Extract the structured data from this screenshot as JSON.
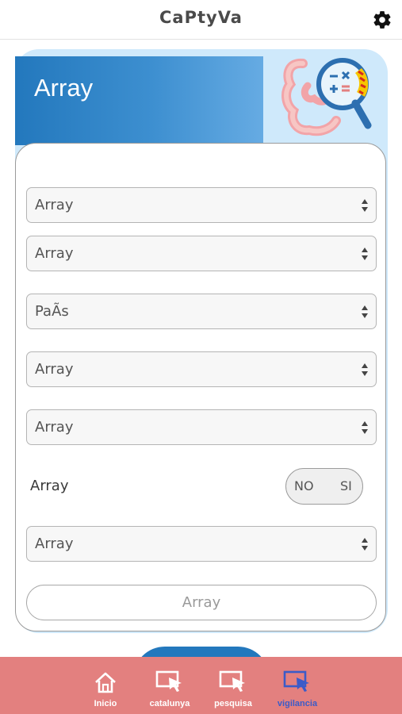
{
  "app": {
    "title": "CaPtyVa"
  },
  "header": {
    "title": "Array"
  },
  "form": {
    "selects": [
      "Array",
      "Array",
      "PaÃs",
      "Array",
      "Array",
      "Array"
    ],
    "toggle": {
      "label": "Array",
      "no": "NO",
      "si": "SI"
    },
    "submit_label": "Array"
  },
  "nav": [
    {
      "label": "Inicio",
      "icon": "home-icon",
      "active": false
    },
    {
      "label": "catalunya",
      "icon": "cursor-screen-icon",
      "active": false
    },
    {
      "label": "pesquisa",
      "icon": "cursor-screen-icon",
      "active": false
    },
    {
      "label": "vigilancia",
      "icon": "cursor-screen-icon",
      "active": true
    }
  ],
  "colors": {
    "accent": "#2378bd",
    "nav_bg": "#e3807f",
    "nav_active": "#3b5bc8",
    "card_bg": "#cfe9fb"
  }
}
